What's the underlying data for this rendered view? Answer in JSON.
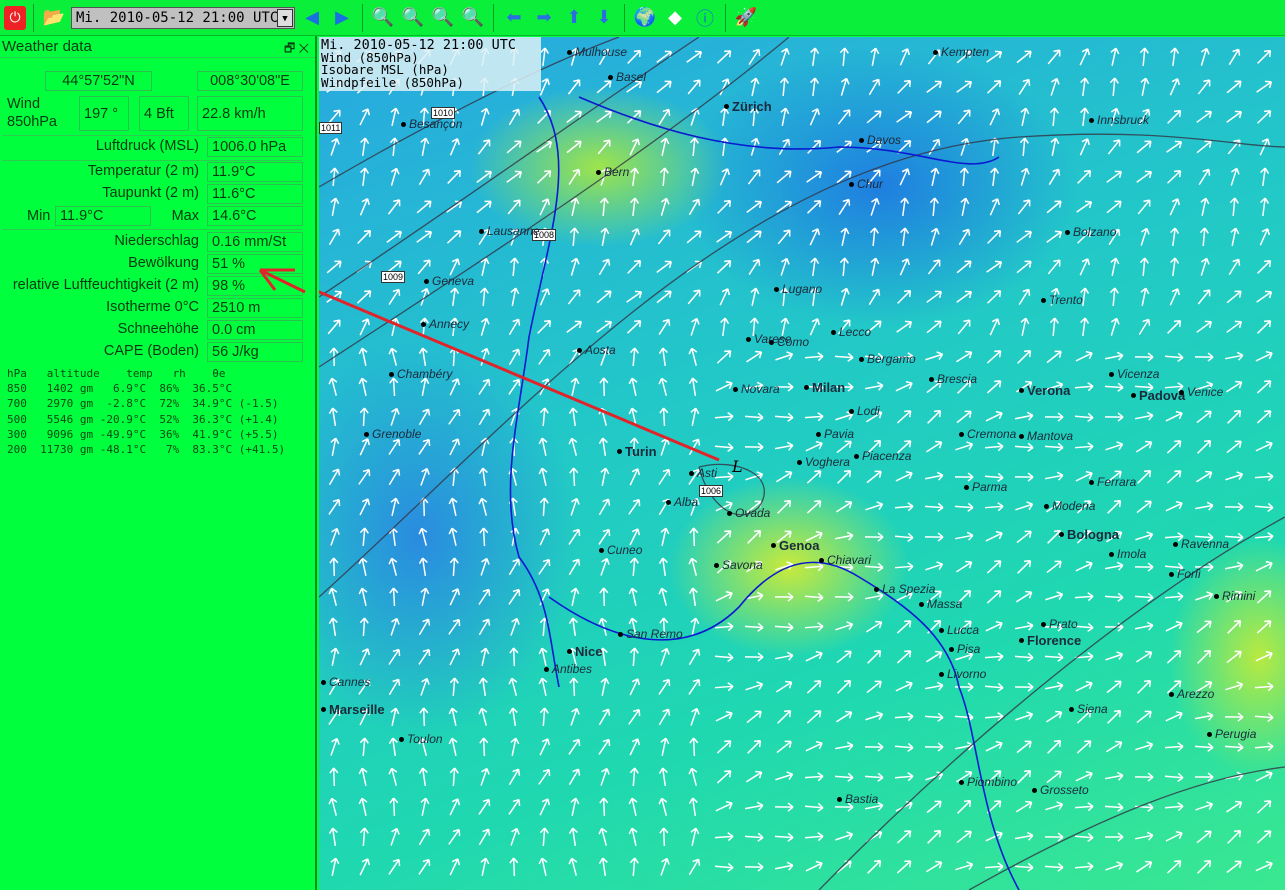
{
  "toolbar": {
    "date_value": "Mi. 2010-05-12 21:00 UTC",
    "icons": [
      "power-icon",
      "open-folder-icon",
      "prev-icon",
      "next-icon",
      "zoom-in-icon",
      "zoom-out-icon",
      "zoom-fit-icon",
      "zoom-1to1-icon",
      "pan-left-icon",
      "pan-right-icon",
      "pan-up-icon",
      "pan-down-icon",
      "globe-icon",
      "eraser-icon",
      "info-icon",
      "rocket-icon"
    ]
  },
  "panel": {
    "title": "Weather data",
    "lat": "44°57'52\"N",
    "lon": "008°30'08\"E",
    "wind_label": "Wind",
    "wind_level": "850hPa",
    "wind_dir": "197 °",
    "wind_bft": "4 Bft",
    "wind_speed": "22.8 km/h",
    "pressure_label": "Luftdruck (MSL)",
    "pressure": "1006.0 hPa",
    "temp_label": "Temperatur (2 m)",
    "temp": "11.9°C",
    "dew_label": "Taupunkt (2 m)",
    "dew": "11.6°C",
    "min_label": "Min",
    "min": "11.9°C",
    "max_label": "Max",
    "max": "14.6°C",
    "precip_label": "Niederschlag",
    "precip": "0.16 mm/St",
    "cloud_label": "Bewölkung",
    "cloud": "51 %",
    "rh_label": "relative Luftfeuchtigkeit (2 m)",
    "rh": "98 %",
    "iso0_label": "Isotherme 0°C",
    "iso0": "2510 m",
    "snow_label": "Schneehöhe",
    "snow": "0.0 cm",
    "cape_label": "CAPE (Boden)",
    "cape": "56 J/kg",
    "sounding": "hPa   altitude    temp   rh    θe\n850   1402 gm   6.9°C  86%  36.5°C\n700   2970 gm  -2.8°C  72%  34.9°C (-1.5)\n500   5546 gm -20.9°C  52%  36.3°C (+1.4)\n300   9096 gm -49.9°C  36%  41.9°C (+5.5)\n200  11730 gm -48.1°C   7%  83.3°C (+41.5)"
  },
  "map": {
    "legend_date": "Mi. 2010-05-12 21:00 UTC",
    "legend_lines": [
      "Wind (850hPa)",
      "Isobare MSL (hPa)",
      "Windpfeile (850hPa)"
    ],
    "low_marker": "L",
    "isobars": [
      "1011",
      "1010",
      "1009",
      "1008",
      "1006"
    ],
    "cities": [
      "Mulhouse",
      "Basel",
      "Zürich",
      "Bern",
      "Lausanne",
      "Besançon",
      "Geneva",
      "Annecy",
      "Chambéry",
      "Grenoble",
      "Aosta",
      "Turin",
      "Milan",
      "Novara",
      "Asti",
      "Alba",
      "Cuneo",
      "Genoa",
      "Savona",
      "Nice",
      "Marseille",
      "Toulon",
      "Cannes",
      "Antibes",
      "San Remo",
      "Bergamo",
      "Brescia",
      "Verona",
      "Padova",
      "Venice",
      "Bologna",
      "Modena",
      "Parma",
      "Piacenza",
      "Pavia",
      "Lugano",
      "Bolzano",
      "Trento",
      "Innsbruck",
      "Kempten",
      "Florence",
      "Pisa",
      "Livorno",
      "Lucca",
      "Prato",
      "Siena",
      "Ravenna",
      "Ferrara",
      "La Spezia",
      "Massa",
      "Arezzo",
      "Perugia",
      "Grosseto",
      "Piombino",
      "Bastia",
      "Chur",
      "Davos",
      "Lecco",
      "Como",
      "Varese",
      "Vicenza",
      "Rimini",
      "Imola",
      "Forlì",
      "Mantova",
      "Cremona",
      "Lodi",
      "Voghera",
      "Ovada",
      "Chiavari"
    ]
  }
}
